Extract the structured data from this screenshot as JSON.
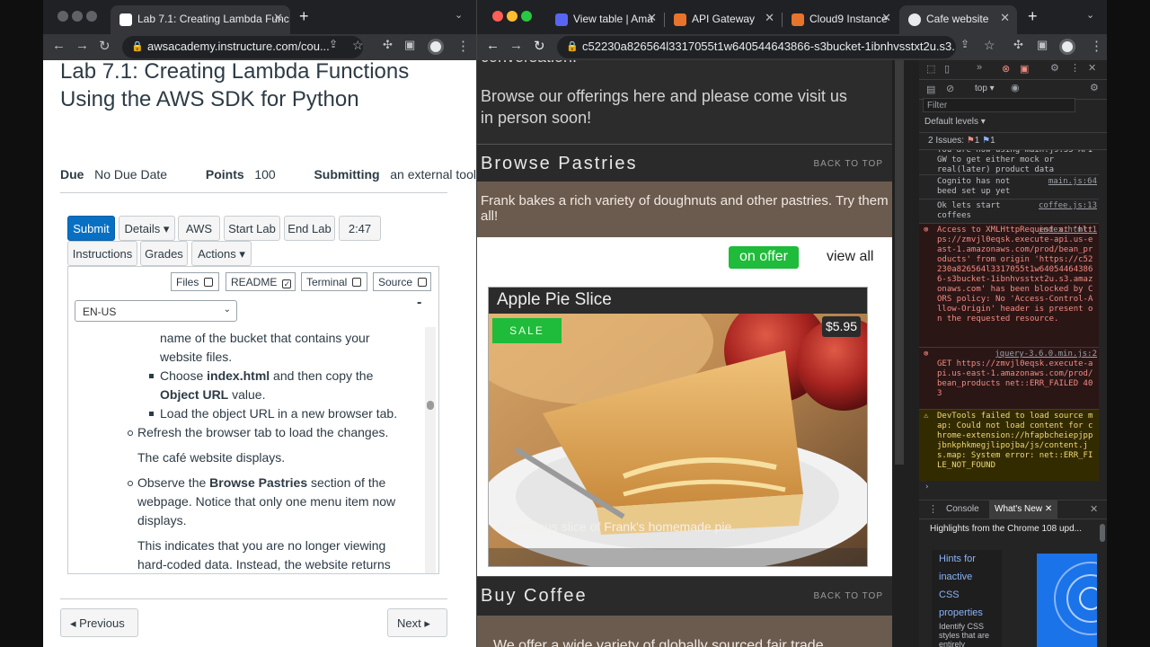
{
  "left_browser": {
    "tab_title": "Lab 7.1: Creating Lambda Func",
    "address": "awsacademy.instructure.com/cou...",
    "lab": {
      "title": "Lab 7.1: Creating Lambda Functions Using the AWS SDK for Python",
      "due_label": "Due",
      "due_value": "No Due Date",
      "points_label": "Points",
      "points_value": "100",
      "submitting_label": "Submitting",
      "submitting_value": "an external tool"
    },
    "buttons": [
      "Submit",
      "Details",
      "AWS",
      "Start Lab",
      "End Lab",
      "2:47",
      "Instructions",
      "Grades",
      "Actions"
    ],
    "checkboxes": [
      {
        "label": "Files",
        "checked": false
      },
      {
        "label": "README",
        "checked": true
      },
      {
        "label": "Terminal",
        "checked": false
      },
      {
        "label": "Source",
        "checked": false
      }
    ],
    "collapse_symbol": "-",
    "language": "EN-US",
    "instructions": {
      "l1": "name of the bucket that contains your",
      "l2": "website files.",
      "b1_pre": "Choose ",
      "b1_bold": "index.html",
      "b1_post": " and then copy the",
      "b1b_bold": "Object URL",
      "b1b_post": " value.",
      "b2": "Load the object URL in a new browser tab.",
      "c1": "Refresh the browser tab to load the changes.",
      "p1": "The café website displays.",
      "c2_pre": "Observe the ",
      "c2_bold": "Browse Pastries",
      "c2_post": " section of the",
      "c2b": "webpage. Notice that only one menu item now",
      "c2c": "displays.",
      "p2": "This indicates that you are no longer viewing",
      "p2b": "hard-coded data. Instead, the website returns"
    },
    "nav": {
      "previous": "Previous",
      "next": "Next"
    }
  },
  "right_browser": {
    "tabs": [
      {
        "label": "View table | Ama",
        "color": "#5865f2"
      },
      {
        "label": "API Gateway",
        "color": "#e8742c"
      },
      {
        "label": "Cloud9 Instance",
        "color": "#e8742c"
      },
      {
        "label": "Cafe website",
        "color": "#e8eaed"
      }
    ],
    "address": "c52230a826564l3317055t1w640544643866-s3bucket-1ibnhvsstxt2u.s3...",
    "page": {
      "top_text": "conversation.",
      "browse_line1": "Browse our offerings here and please come visit us",
      "browse_line2": "in person soon!",
      "pastries_title": "Browse Pastries",
      "back_to_top": "BACK TO TOP",
      "pastries_desc": "Frank bakes a rich variety of doughnuts and other pastries. Try them all!",
      "on_offer": "on offer",
      "view_all": "view all",
      "item": {
        "name": "Apple Pie Slice",
        "price": "$5.95",
        "badge": "SALE",
        "caption": "A delicious slice of Frank's homemade pie."
      },
      "coffee_title": "Buy Coffee",
      "coffee_desc": "We offer a wide variety of globally sourced fair trade"
    },
    "devtools": {
      "context": "top",
      "filter_placeholder": "Filter",
      "levels": "Default levels",
      "issues_label": "2 Issues:",
      "issues_errors": "1",
      "issues_info": "1",
      "logs": [
        {
          "type": "info",
          "text": "You are now using main.js:55 API GW to get either mock or real(later) product data",
          "source": ""
        },
        {
          "type": "info",
          "text": "Cognito has not beed set up yet",
          "source": "main.js:64"
        },
        {
          "type": "info",
          "text": "Ok lets start coffees",
          "source": "coffee.js:13"
        },
        {
          "type": "error",
          "text": "Access to XMLHttpRequest at 'https://zmvjl0eqsk.execute-api.us-east-1.amazonaws.com/prod/bean_products' from origin 'https://c52230a826564l3317055t1w640544643866-s3bucket-1ibnhvsstxt2u.s3.amazonaws.com' has been blocked by CORS policy: No 'Access-Control-Allow-Origin' header is present on the requested resource.",
          "source": "index.html:1"
        },
        {
          "type": "error",
          "text": "GET https://zmvjl0eqsk.execute-api.us-east-1.amazonaws.com/prod/bean_products net::ERR_FAILED 403",
          "source": "jquery-3.6.0.min.js:2"
        },
        {
          "type": "warn",
          "text": "DevTools failed to load source map: Could not load content for chrome-extension://hfapbcheiepjppjbnkphkmegjlipojba/js/content.js.map: System error: net::ERR_FILE_NOT_FOUND",
          "source": ""
        }
      ],
      "drawer_tabs": [
        "Console",
        "What's New"
      ],
      "whats_new": "Highlights from the Chrome 108 upd...",
      "hint_lines": [
        "Hints for",
        "inactive",
        "CSS",
        "properties"
      ],
      "hint_sub": "Identify CSS styles that are entirely"
    }
  }
}
